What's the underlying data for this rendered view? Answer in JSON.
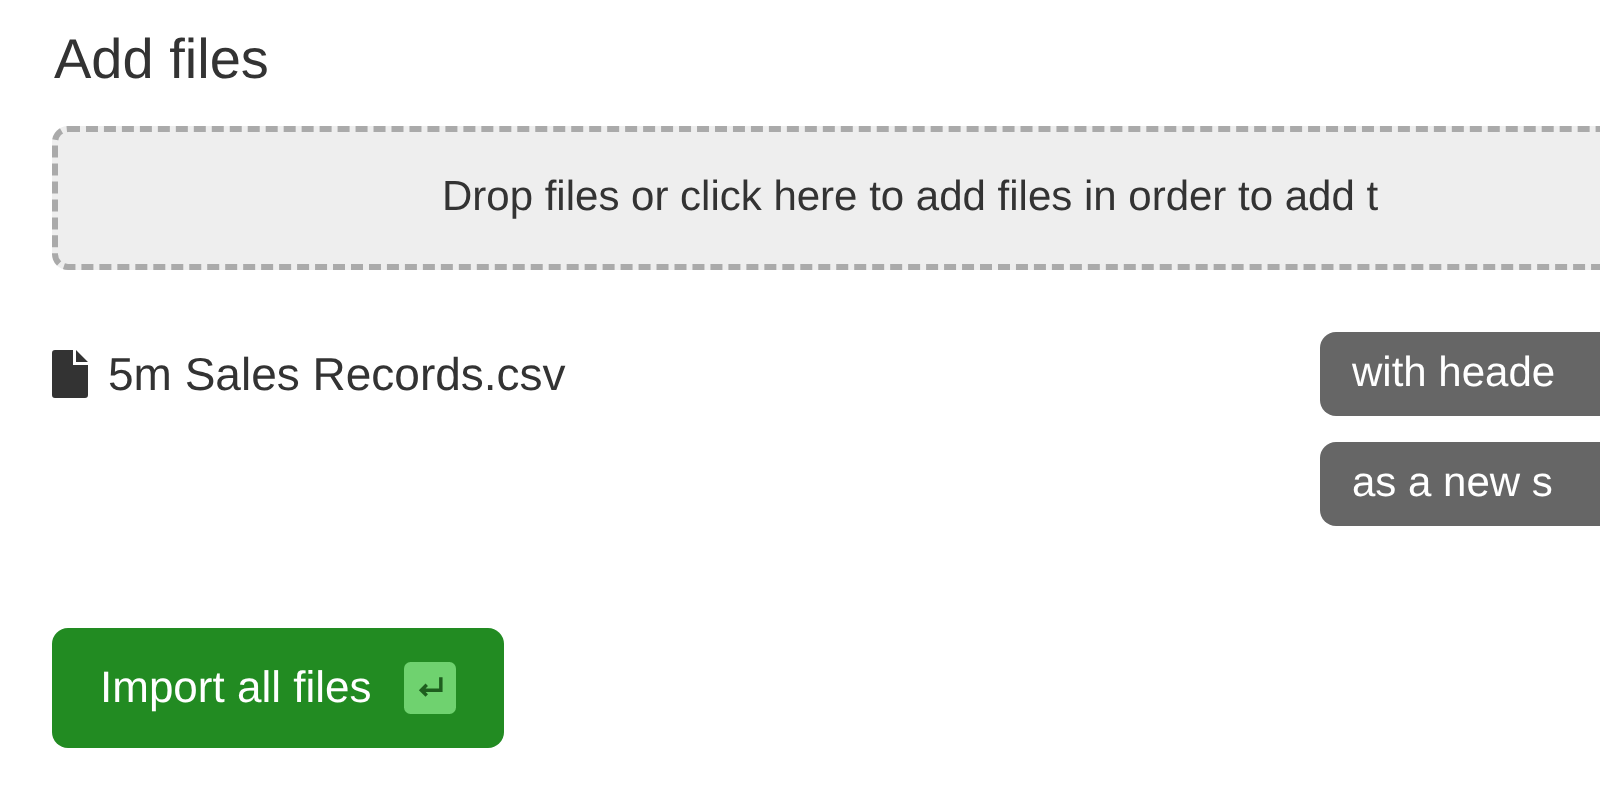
{
  "title": "Add files",
  "dropzone": {
    "text": "Drop files or click here to add files in order to add t"
  },
  "files": [
    {
      "name": "5m Sales Records.csv",
      "options": [
        "with heade",
        "as a new s"
      ]
    }
  ],
  "import_button": {
    "label": "Import all files"
  }
}
